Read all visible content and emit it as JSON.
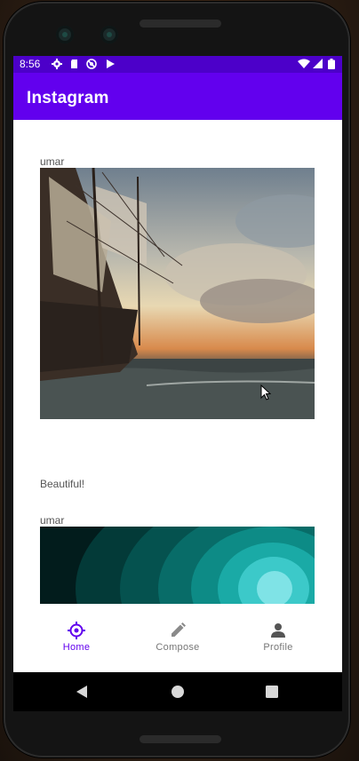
{
  "status_bar": {
    "time": "8:56",
    "left_icons": [
      "settings-icon",
      "sd-card-icon",
      "no-sim-icon",
      "play-store-icon"
    ],
    "right_icons": [
      "wifi-icon",
      "signal-icon",
      "battery-icon"
    ]
  },
  "app_bar": {
    "title": "Instagram"
  },
  "posts": [
    {
      "username": "umar",
      "image": "sailing-ship-sunset-image",
      "caption": "Beautiful!"
    },
    {
      "username": "umar",
      "image": "teal-abstract-image",
      "caption": ""
    }
  ],
  "bottom_nav": {
    "items": [
      {
        "label": "Home",
        "icon": "home-compass-icon",
        "active": true
      },
      {
        "label": "Compose",
        "icon": "pencil-icon",
        "active": false
      },
      {
        "label": "Profile",
        "icon": "person-icon",
        "active": false
      }
    ]
  },
  "system_nav": {
    "icons": [
      "back-icon",
      "home-icon",
      "recents-icon"
    ]
  },
  "colors": {
    "primary": "#6200ee",
    "status_bar": "#4c00c9",
    "active_nav": "#6200ee",
    "inactive_nav": "#777777"
  }
}
